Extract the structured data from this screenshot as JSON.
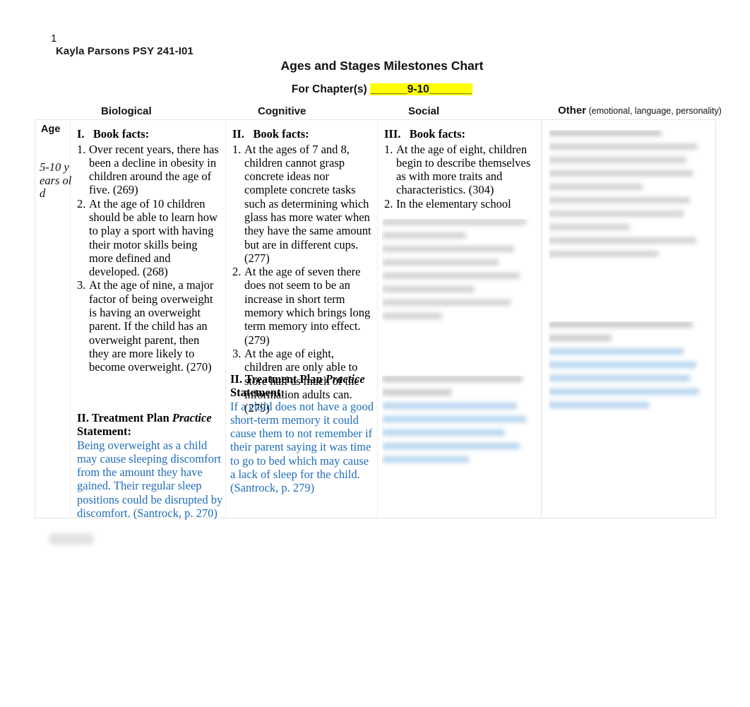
{
  "header": {
    "page_number": "1",
    "byline": "Kayla Parsons PSY 241-I01",
    "title": "Ages and Stages Milestones Chart",
    "chapter_prefix": "For Chapter(s) ",
    "chapter_blank_left": "______",
    "chapter_value": "9-10",
    "chapter_blank_right": "_______"
  },
  "columns": {
    "age": "Age",
    "biological": "Biological",
    "cognitive": "Cognitive",
    "social": "Social",
    "other_bold": "Other",
    "other_sub": " (emotional, language, personality)"
  },
  "row": {
    "age_value": "5-10 years old",
    "biological": {
      "facts_heading": "I.   Book facts:",
      "facts": [
        {
          "marker": "1.",
          "text": "Over recent years, there has been a decline in obesity in children around the age of five. (269)"
        },
        {
          "marker": "2.",
          "text": "At the age of 10 children should be able to learn how to play a sport with having their motor skills being more defined and developed. (268)"
        },
        {
          "marker": "3.",
          "text": "At the age of nine, a major factor of being overweight is having an overweight parent. If the child has an overweight parent, then they are more likely to become overweight. (270)"
        }
      ],
      "treatment_plan_label": "II. Treatment Plan ",
      "treatment_plan_italic": "Practice",
      "treatment_plan_label2": "Statement:",
      "treatment_plan_text": "Being overweight as a child may cause sleeping discomfort from the amount they have gained. Their regular sleep positions could be disrupted by discomfort. (Santrock, p. 270)"
    },
    "cognitive": {
      "facts_heading": "II.   Book facts:",
      "facts": [
        {
          "marker": "1.",
          "text": "At the ages of 7 and 8, children cannot grasp concrete ideas nor complete concrete tasks such as determining which glass has more water when they have the same amount but are in different cups. (277)"
        },
        {
          "marker": "2.",
          "text": "At the age of seven there does not seem to be an increase in short term memory which brings long term memory into effect. (279)"
        },
        {
          "marker": "3.",
          "text": "At the age of eight, children are only able to store half as much of the information adults can. (279)"
        }
      ],
      "treatment_plan_label": "II. Treatment Plan ",
      "treatment_plan_italic": "Practice",
      "treatment_plan_label2": "Statement:",
      "treatment_plan_text": "If a child does not have a good short-term memory it could cause them to not remember if their parent saying it was time to go to bed which may cause a lack of sleep for the child. (Santrock, p. 279)"
    },
    "social": {
      "facts_heading": "III.   Book facts:",
      "facts": [
        {
          "marker": "1.",
          "text": "At the age of eight, children begin to describe themselves as with more traits and characteristics. (304)"
        },
        {
          "marker": "2.",
          "text": "In the elementary school"
        }
      ]
    },
    "other": {}
  },
  "colors": {
    "highlight": "#ffff00",
    "treatment_text": "#1f6cb8",
    "body_text": "#000000",
    "table_border": "#e3e3e3"
  }
}
